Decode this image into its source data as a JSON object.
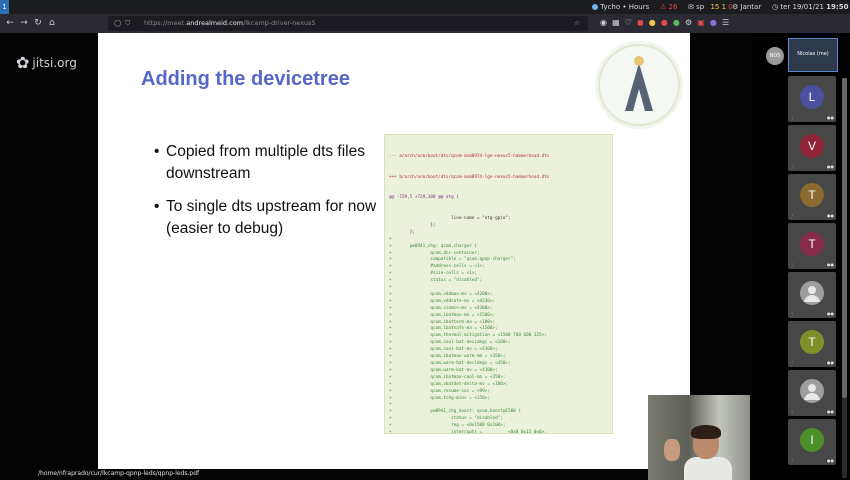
{
  "topbar": {
    "workspace": "1",
    "app_title": "Tycho • Hours",
    "alert_count": "26",
    "mail_label": "sp",
    "mail_count_a": "15",
    "mail_count_b": "1",
    "mail_count_c": "0",
    "user_label": "Jantar",
    "datetime": "ter 19/01/21",
    "time": "19:50"
  },
  "browser": {
    "url_prefix": "https://meet.",
    "url_host": "andrealmeid.com",
    "url_path": "/lkcamp-driver-nexus5"
  },
  "jitsi": {
    "logo_text": "jitsi.org"
  },
  "slide": {
    "title": "Adding the devicetree",
    "bullets": [
      "Copied from multiple dts files downstream",
      "To single dts upstream for now (easier to debug)"
    ],
    "code_header_a": "--- a/arch/arm/boot/dts/qcom-msm8974-lge-nexus5-hammerhead.dts",
    "code_header_b": "+++ b/arch/arm/boot/dts/qcom-msm8974-lge-nexus5-hammerhead.dts",
    "code_hunk": "@@ -729,5 +729,108 @@ etg {",
    "code_lines": [
      "                        line-name = \"otg-gpio\";",
      "                };",
      "        };",
      "+",
      "+       pm8941_chg: qcom,charger {",
      "+               qcom,dcc-container;",
      "+               compatible = \"qcom,qpnp-charger\";",
      "+               #address-cells = <1>;",
      "+               #size-cells = <1>;",
      "+               status = \"disabled\";",
      "+",
      "+               qcom,vddmax-mv = <4200>;",
      "+               qcom,vddsafe-mv = <4230>;",
      "+               qcom,vinmin-mv = <4300>;",
      "+               qcom,ibatmax-ma = <1500>;",
      "+               qcom,ibatterm-ma = <100>;",
      "+               qcom,ibatsafe-ma = <1500>;",
      "+               qcom,thermal-mitigation = <1500 700 600 325>;",
      "+               qcom,cool-bat-decidegc = <100>;",
      "+               qcom,cool-bat-mv = <4100>;",
      "+               qcom,ibatmax-warm-ma = <350>;",
      "+               qcom,warm-bat-decidegc = <450>;",
      "+               qcom,warm-bat-mv = <4100>;",
      "+               qcom,ibatmax-cool-ma = <350>;",
      "+               qcom,vbatdet-delta-mv = <100>;",
      "+               qcom,resume-soc = <99>;",
      "+               qcom,tchg-mins = <150>;",
      "+",
      "+               pm8941_chg_boost: qcom,boost@1500 {",
      "+                       status = \"disabled\";",
      "+                       reg = <0x1500 0x100>;",
      "+                       interrupts =          <0x0 0x15 0x0>,",
      "+                                             <0x0 0x15 0x1>;",
      "+",
      "+                       interrupt-names =         \"boost-pwr-ok\",",
      "+                                               \"limit-error\";",
      "+               };",
      "+       };"
    ]
  },
  "status_path": "/home/nfraprado/cur/lkcamp-qpnp-leds/qpnp-leds.pdf",
  "participants": {
    "local_name": "Nicolas (me)",
    "local_initials": "NDS",
    "remote": [
      {
        "initial": "L",
        "color": "#4a4f9e"
      },
      {
        "initial": "V",
        "color": "#8f2438"
      },
      {
        "initial": "T",
        "color": "#8a6a2e"
      },
      {
        "initial": "T",
        "color": "#8a2a4a"
      },
      {
        "initial": "",
        "color": "#9e9e9e"
      },
      {
        "initial": "T",
        "color": "#7f8f2a"
      },
      {
        "initial": "",
        "color": "#9e9e9e"
      },
      {
        "initial": "I",
        "color": "#4f8f2a"
      }
    ]
  },
  "colors": {
    "slide_title": "#5567c9",
    "code_bg": "#ecf2d9",
    "code_add": "#3c8a3c"
  }
}
